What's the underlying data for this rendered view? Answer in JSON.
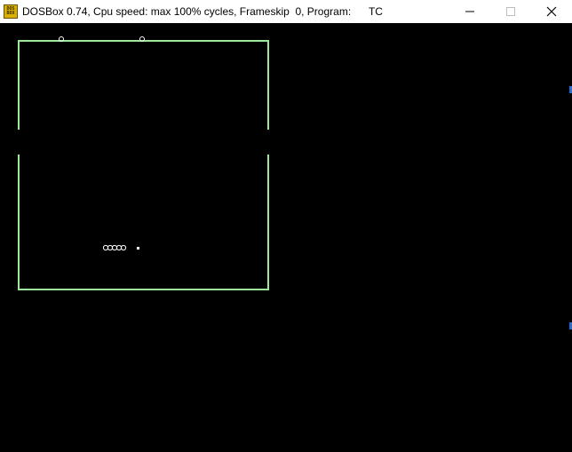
{
  "window": {
    "title": "DOSBox 0.74, Cpu speed: max 100% cycles, Frameskip  0, Program:      TC",
    "icon_text_top": "DOS",
    "icon_text_bottom": "BOX",
    "minimize_icon": "minimize-icon",
    "maximize_icon": "maximize-icon",
    "close_icon": "close-icon"
  },
  "game": {
    "playfield_border_color": "#9ee89e",
    "snake_color": "#ffffff",
    "food_color": "#ffffff",
    "snake_segments": 5
  }
}
